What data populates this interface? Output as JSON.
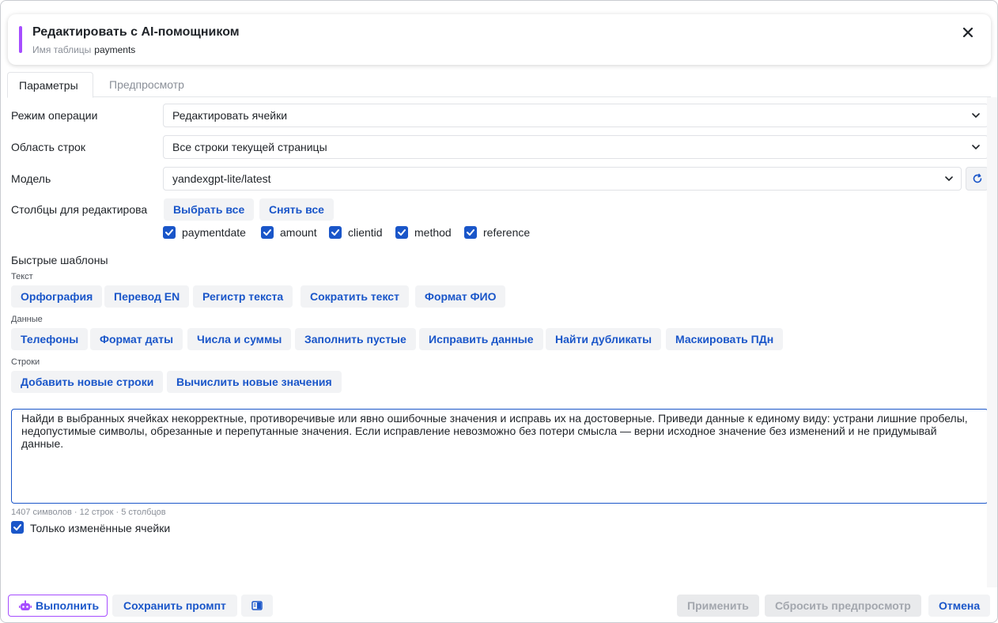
{
  "header": {
    "title": "Редактировать с AI-помощником",
    "table_label": "Имя таблицы",
    "table_name": "payments",
    "close_glyph": "✕",
    "accent_color": "#a64dff"
  },
  "tabs": [
    {
      "label": "Параметры",
      "active": true
    },
    {
      "label": "Предпросмотр",
      "active": false
    }
  ],
  "form": {
    "operation_mode": {
      "label": "Режим операции",
      "value": "Редактировать ячейки"
    },
    "row_scope": {
      "label": "Область строк",
      "value": "Все строки текущей страницы"
    },
    "model": {
      "label": "Модель",
      "value": "yandexgpt-lite/latest"
    },
    "columns": {
      "label": "Столбцы для редактирова",
      "select_all": "Выбрать все",
      "deselect_all": "Снять все",
      "items": [
        {
          "name": "paymentdate",
          "checked": true
        },
        {
          "name": "amount",
          "checked": true
        },
        {
          "name": "clientid",
          "checked": true
        },
        {
          "name": "method",
          "checked": true
        },
        {
          "name": "reference",
          "checked": true
        }
      ]
    }
  },
  "templates": {
    "title": "Быстрые шаблоны",
    "groups": [
      {
        "label": "Текст",
        "items": [
          "Орфография",
          "Перевод EN",
          "Регистр текста",
          "Сократить текст",
          "Формат ФИО"
        ]
      },
      {
        "label": "Данные",
        "items": [
          "Телефоны",
          "Формат даты",
          "Числа и суммы",
          "Заполнить пустые",
          "Исправить данные",
          "Найти дубликаты",
          "Маскировать ПДн"
        ]
      },
      {
        "label": "Строки",
        "items": [
          "Добавить новые строки",
          "Вычислить новые значения"
        ]
      }
    ]
  },
  "prompt": {
    "text": "Найди в выбранных ячейках некорректные, противоречивые или явно ошибочные значения и исправь их на достоверные. Приведи данные к единому виду: устрани лишние пробелы, недопустимые символы, обрезанные и перепутанные значения. Если исправление невозможно без потери смысла — верни исходное значение без изменений и не придумывай данные.",
    "counter": "1407 символов · 12 строк · 5 столбцов"
  },
  "only_changed": {
    "label": "Только изменённые ячейки",
    "checked": true
  },
  "footer": {
    "run": "Выполнить",
    "save_prompt": "Сохранить промпт",
    "apply": "Применить",
    "reset_preview": "Сбросить предпросмотр",
    "cancel": "Отмена"
  },
  "colors": {
    "link": "#1a56c9",
    "accent": "#a64dff",
    "soft_bg": "#f2f3f5"
  }
}
